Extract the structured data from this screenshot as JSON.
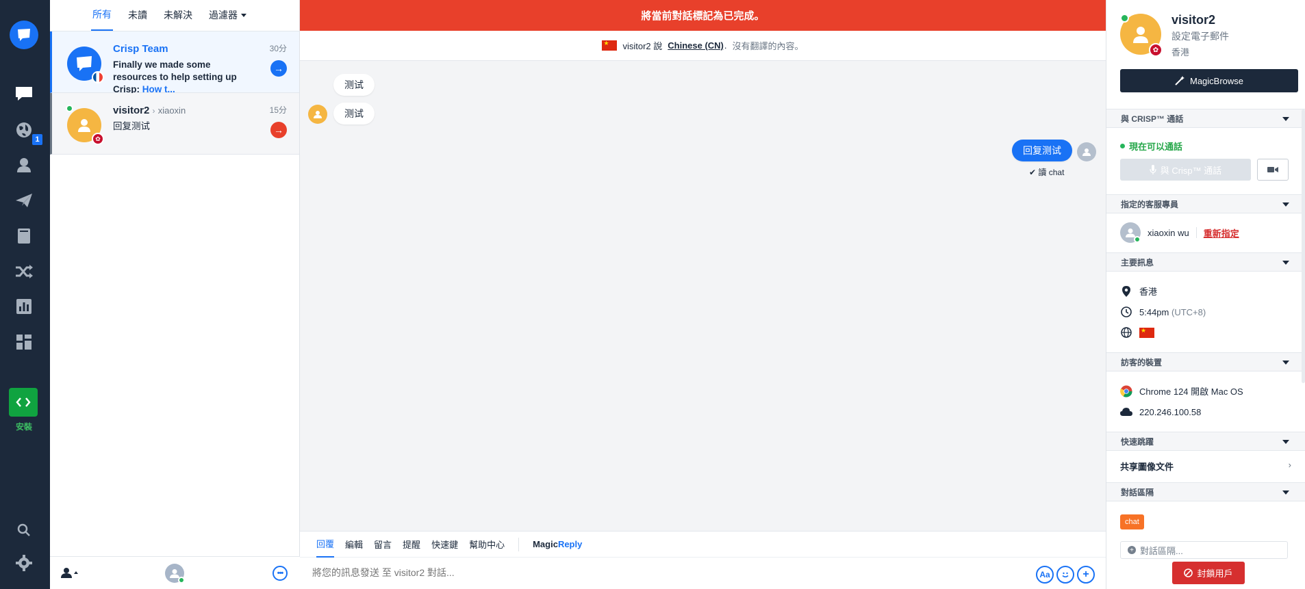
{
  "rail": {
    "badge_count": "1",
    "install_label": "安裝",
    "icons": [
      "chat-bubble-icon",
      "globe-icon",
      "user-icon",
      "paper-plane-icon",
      "book-icon",
      "shuffle-icon",
      "bar-chart-icon",
      "plugins-icon",
      "search-icon",
      "gear-icon"
    ]
  },
  "list": {
    "tabs": {
      "all": "所有",
      "unread": "未讀",
      "unresolved": "未解決",
      "filters": "過濾器"
    },
    "conversations": [
      {
        "name": "Crisp Team",
        "time": "30分",
        "message": "Finally we made some resources to help setting up Crisp: ",
        "link": "How t...",
        "go_color": "#1972f5"
      },
      {
        "name": "visitor2",
        "assignee": "xiaoxin",
        "time": "15分",
        "message": "回复测试",
        "go_color": "#e8402b"
      }
    ]
  },
  "chat": {
    "banner": "將當前對話標記為已完成。",
    "lang_prefix": "visitor2 說",
    "lang_name": "Chinese (CN)",
    "lang_suffix": "沒有翻譯的內容。",
    "messages": [
      {
        "from": "visitor",
        "text": "测试"
      },
      {
        "from": "visitor",
        "text": "测试"
      },
      {
        "from": "operator",
        "text": "回复测试"
      }
    ],
    "read_receipt": "✔ 讀 chat",
    "composer_tabs": [
      "回覆",
      "編輯",
      "留言",
      "提醒",
      "快速鍵",
      "幫助中心"
    ],
    "magic_reply_a": "Magic",
    "magic_reply_b": "Reply",
    "input_placeholder": "將您的訊息發送 至 visitor2 對話...",
    "tool_aa": "Aa"
  },
  "panel": {
    "name": "visitor2",
    "email_prompt": "設定電子郵件",
    "location": "香港",
    "magicbrowse": "MagicBrowse",
    "sections": {
      "call": "與 CRISP™ 通話",
      "assigned": "指定的客服專員",
      "main_info": "主要訊息",
      "device": "訪客的裝置",
      "shortcuts": "快速跳躍",
      "segments": "對話區隔"
    },
    "call_available": "現在可以通話",
    "call_button": "與 Crisp™ 通話",
    "agent_name": "xiaoxin wu",
    "reassign": "重新指定",
    "city": "香港",
    "local_time": "5:44pm",
    "timezone": "(UTC+8)",
    "browser": "Chrome 124 開啟 Mac OS",
    "ip": "220.246.100.58",
    "shared_files": "共享圖像文件",
    "segment_tag": "chat",
    "segment_placeholder": "對話區隔...",
    "block_button": "封鎖用戶"
  }
}
